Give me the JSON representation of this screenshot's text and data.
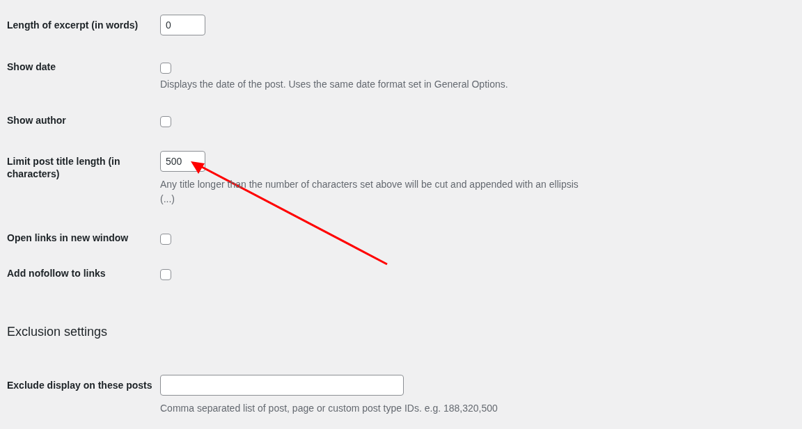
{
  "sections": [
    {
      "rows": [
        {
          "kind": "number",
          "label": "Length of excerpt (in words)",
          "value": "0"
        },
        {
          "kind": "checkbox",
          "label": "Show date",
          "checked": false,
          "description": "Displays the date of the post. Uses the same date format set in General Options."
        },
        {
          "kind": "checkbox",
          "label": "Show author",
          "checked": false
        },
        {
          "kind": "number",
          "label": "Limit post title length (in characters)",
          "value": "500",
          "description": "Any title longer than the number of characters set above will be cut and appended with an ellipsis (...)"
        },
        {
          "kind": "checkbox",
          "label": "Open links in new window",
          "checked": false
        },
        {
          "kind": "checkbox",
          "label": "Add nofollow to links",
          "checked": false
        }
      ]
    },
    {
      "heading": "Exclusion settings",
      "rows": [
        {
          "kind": "text",
          "label": "Exclude display on these posts",
          "value": "",
          "description": "Comma separated list of post, page or custom post type IDs. e.g. 188,320,500"
        }
      ]
    }
  ]
}
